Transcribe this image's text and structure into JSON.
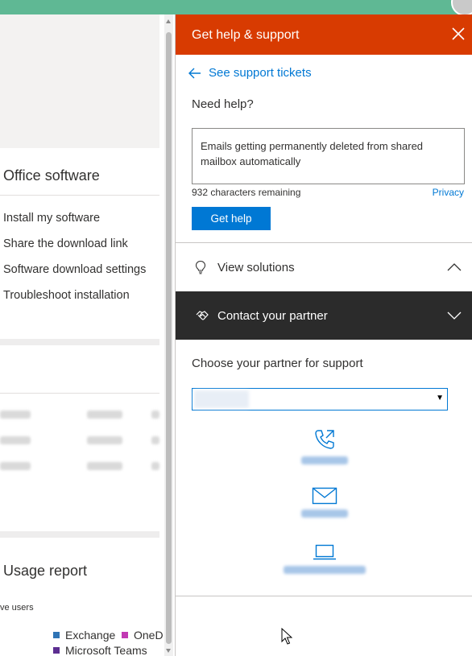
{
  "left_panel": {
    "office_section_title": "Office software",
    "office_links": [
      "Install my software",
      "Share the download link",
      "Software download settings",
      "Troubleshoot installation"
    ],
    "usage_title": "Usage report",
    "usage_subtitle": "ve users",
    "legend": [
      {
        "label": "Exchange",
        "color": "#2f74b5"
      },
      {
        "label": "OneD",
        "color": "#c239b3"
      },
      {
        "label": "Microsoft Teams",
        "color": "#5c2e91"
      }
    ]
  },
  "panel": {
    "title": "Get help & support",
    "back_link": "See support tickets",
    "need_help": "Need help?",
    "textarea_value": "Emails getting permanently deleted from shared mailbox automatically",
    "remaining": "932 characters remaining",
    "privacy": "Privacy",
    "get_help_button": "Get help",
    "view_solutions": "View solutions",
    "contact_partner": "Contact your partner",
    "choose_partner": "Choose your partner for support",
    "accent_color": "#d83b01",
    "link_color": "#0078d4"
  }
}
